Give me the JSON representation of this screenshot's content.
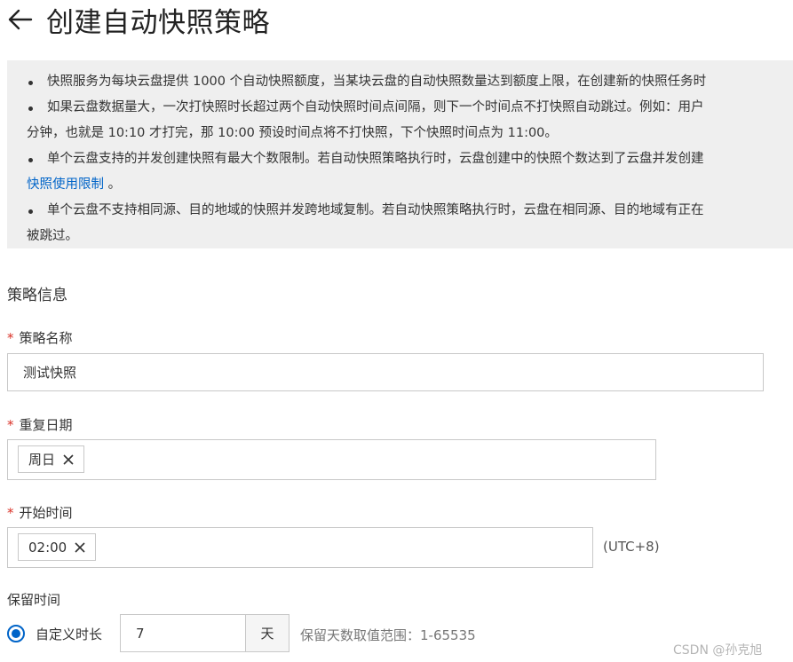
{
  "header": {
    "title": "创建自动快照策略"
  },
  "notice": {
    "lines": [
      "快照服务为每块云盘提供 1000 个自动快照额度，当某块云盘的自动快照数量达到额度上限，在创建新的快照任务时",
      "如果云盘数据量大，一次打快照时长超过两个自动快照时间点间隔，则下一个时间点不打快照自动跳过。例如：用户",
      "分钟，也就是 10:10 才打完，那 10:00 预设时间点将不打快照，下个快照时间点为 11:00。",
      "单个云盘支持的并发创建快照有最大个数限制。若自动快照策略执行时，云盘创建中的快照个数达到了云盘并发创建",
      "快照使用限制",
      " 。",
      "单个云盘不支持相同源、目的地域的快照并发跨地域复制。若自动快照策略执行时，云盘在相同源、目的地域有正在",
      "被跳过。"
    ]
  },
  "section": {
    "title": "策略信息"
  },
  "form": {
    "required_mark": "*",
    "name": {
      "label": "策略名称",
      "value": "测试快照"
    },
    "repeat": {
      "label": "重复日期",
      "tag": "周日"
    },
    "start": {
      "label": "开始时间",
      "tag": "02:00",
      "timezone": "(UTC+8)"
    },
    "retention": {
      "label": "保留时间",
      "option": "自定义时长",
      "value": "7",
      "unit": "天",
      "hint": "保留天数取值范围：1-65535"
    }
  },
  "watermark": "CSDN @孙克旭",
  "colors": {
    "accent": "#0064c8",
    "required": "#d93026",
    "notice_bg": "#efefef"
  }
}
